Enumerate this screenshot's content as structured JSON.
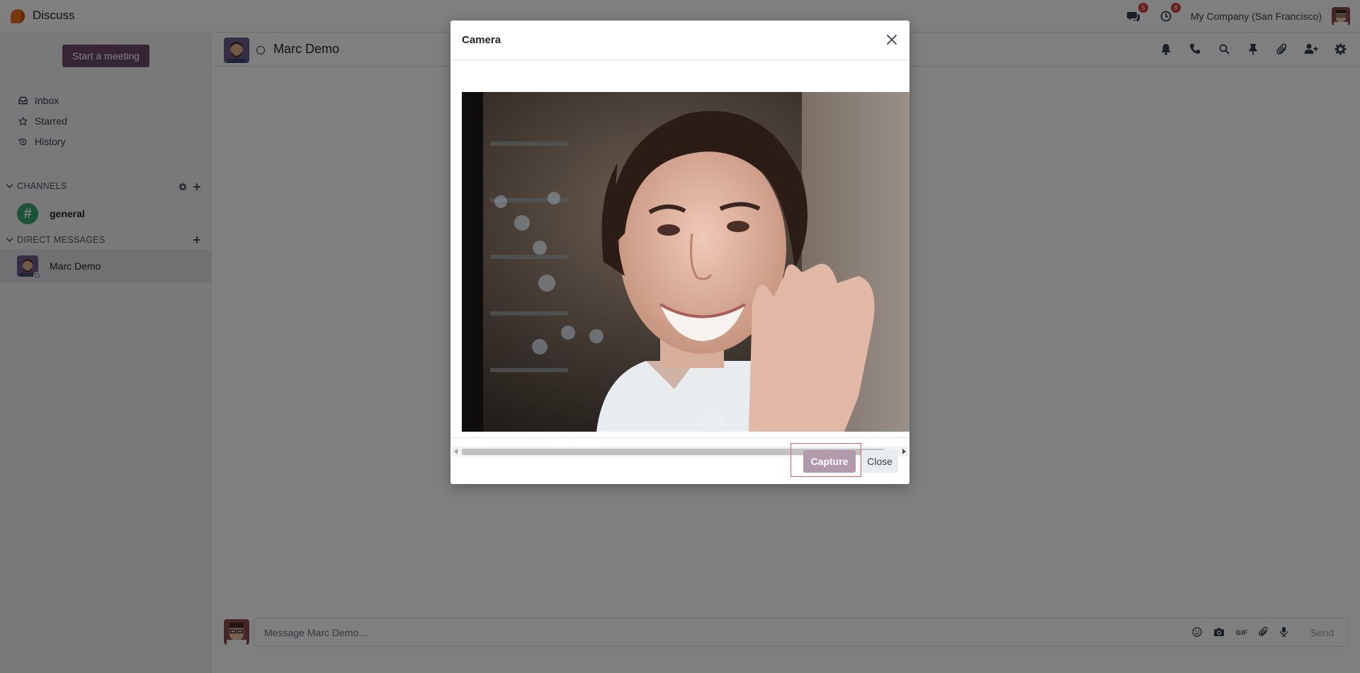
{
  "app": {
    "title": "Discuss"
  },
  "navbar": {
    "messages_badge": "5",
    "activities_badge": "8",
    "company": "My Company (San Francisco)"
  },
  "sidebar": {
    "meeting_button": "Start a meeting",
    "mailboxes": [
      {
        "label": "Inbox",
        "icon": "inbox-icon"
      },
      {
        "label": "Starred",
        "icon": "star-icon"
      },
      {
        "label": "History",
        "icon": "history-icon"
      }
    ],
    "channels_header": "CHANNELS",
    "channels": [
      {
        "name": "general"
      }
    ],
    "dm_header": "DIRECT MESSAGES",
    "direct_messages": [
      {
        "name": "Marc Demo"
      }
    ]
  },
  "thread": {
    "name": "Marc Demo",
    "actions": [
      "bell-icon",
      "phone-icon",
      "search-icon",
      "pin-icon",
      "paperclip-icon",
      "add-user-icon",
      "gear-icon"
    ]
  },
  "composer": {
    "placeholder": "Message Marc Demo…",
    "gif_label": "GIF",
    "send_label": "Send"
  },
  "modal": {
    "title": "Camera",
    "capture_label": "Capture",
    "close_label": "Close"
  },
  "colors": {
    "brand": "#714b67",
    "channel_avatar": "#35a76a",
    "badge": "#d23f3a"
  }
}
